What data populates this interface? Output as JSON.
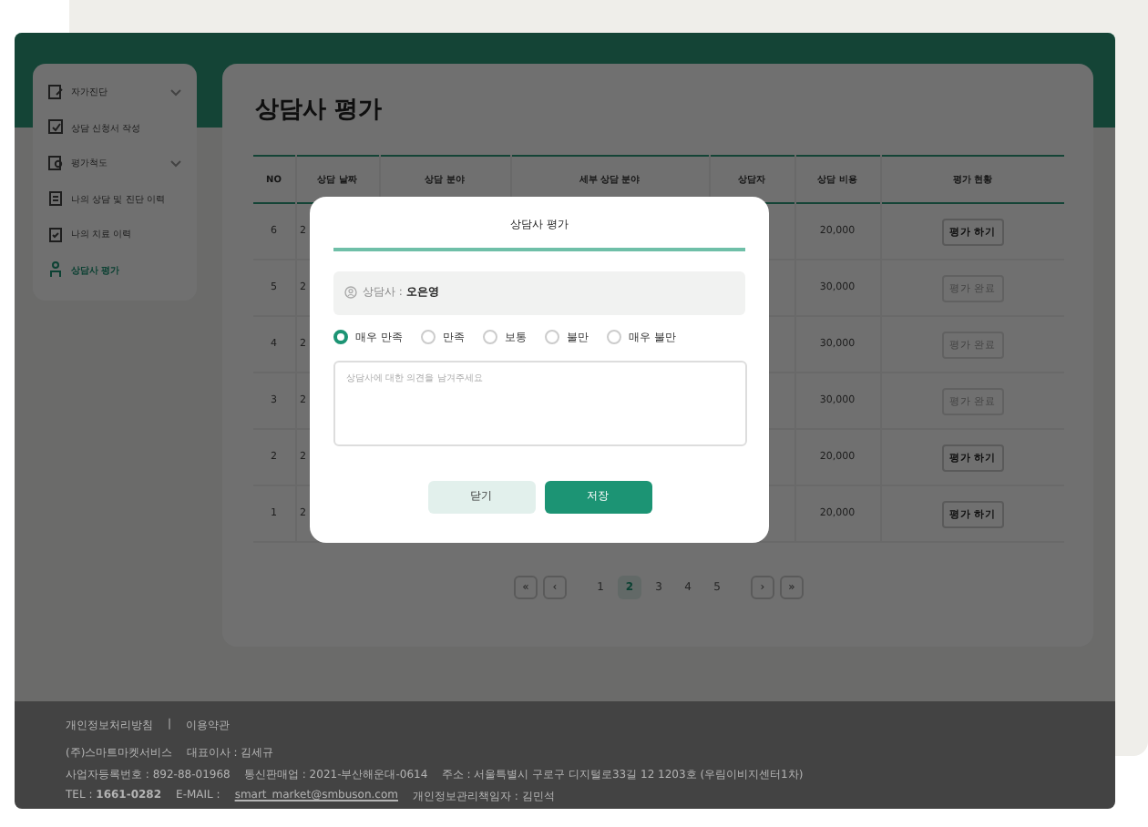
{
  "sidebar": {
    "items": [
      {
        "label": "자가진단",
        "expandable": true,
        "selected": false
      },
      {
        "label": "상담 신청서 작성",
        "expandable": false,
        "selected": false
      },
      {
        "label": "평가척도",
        "expandable": true,
        "selected": false
      },
      {
        "label": "나의 상담 및 진단 이력",
        "expandable": false,
        "selected": false
      },
      {
        "label": "나의 치료 이력",
        "expandable": false,
        "selected": false
      },
      {
        "label": "상담사 평가",
        "expandable": false,
        "selected": true
      }
    ]
  },
  "page": {
    "title": "상담사 평가"
  },
  "table": {
    "columns": [
      "NO",
      "상담 날짜",
      "상담 분야",
      "세부 상담 분야",
      "상담자",
      "상담 비용",
      "평가 현황"
    ],
    "rows": [
      {
        "no": "6",
        "date": "2",
        "cost": "20,000",
        "action": "평가 하기",
        "disabled": false
      },
      {
        "no": "5",
        "date": "2",
        "cost": "30,000",
        "action": "평가 완료",
        "disabled": true
      },
      {
        "no": "4",
        "date": "2",
        "cost": "30,000",
        "action": "평가 완료",
        "disabled": true
      },
      {
        "no": "3",
        "date": "2",
        "cost": "30,000",
        "action": "평가 완료",
        "disabled": true
      },
      {
        "no": "2",
        "date": "2",
        "cost": "20,000",
        "action": "평가 하기",
        "disabled": false
      },
      {
        "no": "1",
        "date": "2",
        "cost": "20,000",
        "action": "평가 하기",
        "disabled": false
      }
    ]
  },
  "pagination": {
    "first": "«",
    "prev": "‹",
    "pages": [
      {
        "label": "1",
        "selected": false
      },
      {
        "label": "2",
        "selected": true
      },
      {
        "label": "3",
        "selected": false
      },
      {
        "label": "4",
        "selected": false
      },
      {
        "label": "5",
        "selected": false
      }
    ],
    "next": "›",
    "last": "»"
  },
  "footer": {
    "links": [
      "개인정보처리방침",
      "|",
      "이용약관"
    ],
    "lines": [
      "(주)스마트마켓서비스    대표이사 : 김세규",
      "사업자등록번호 : 892-88-01968    통신판매업 : 2021-부산해운대-0614    주소 : 서울특별시 구로구 디지털로33길 12 1203호 (우림이비지센터1차)"
    ],
    "contact": {
      "tel_label": "TEL : ",
      "tel": "1661-0282",
      "email_label": "E-MAIL : ",
      "email": "smart_market@smbuson.com",
      "manager": "개인정보관리책임자 : 김민석"
    }
  },
  "modal": {
    "title": "상담사 평가",
    "counselor_label": "상담사 : ",
    "counselor": "오은영",
    "ratings": [
      {
        "label": "매우 만족",
        "selected": true
      },
      {
        "label": "만족",
        "selected": false
      },
      {
        "label": "보통",
        "selected": false
      },
      {
        "label": "불만",
        "selected": false
      },
      {
        "label": "매우 불만",
        "selected": false
      }
    ],
    "comment": {
      "placeholder": "상담사에 대한 의견을 남겨주세요"
    },
    "buttons": [
      {
        "label": "닫기",
        "kind": "secondary"
      },
      {
        "label": "저장",
        "kind": "primary"
      }
    ]
  }
}
